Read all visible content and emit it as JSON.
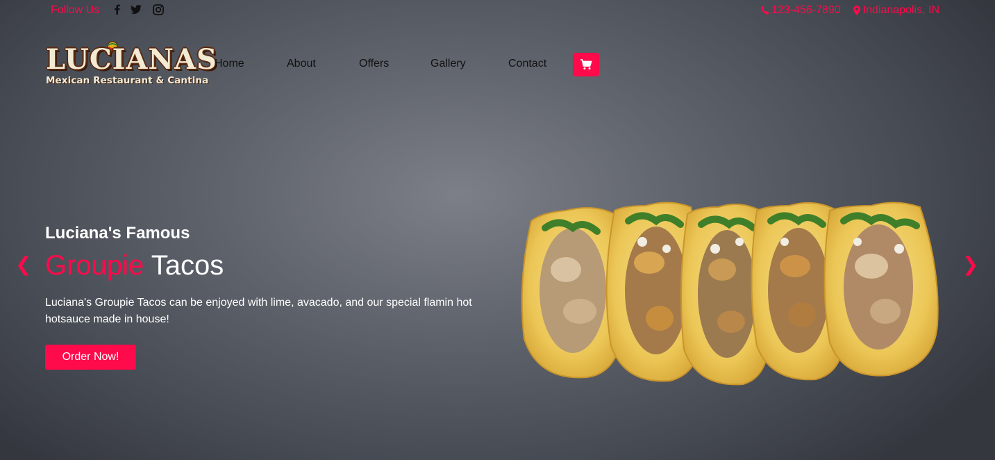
{
  "topbar": {
    "follow_label": "Follow Us",
    "social_icons": [
      "facebook-icon",
      "twitter-icon",
      "instagram-icon"
    ],
    "phone": "123-456-7890",
    "location": "Indianapolis, IN"
  },
  "logo": {
    "name": "LUCIANAS",
    "tagline": "Mexican Restaurant & Cantina"
  },
  "nav": {
    "items": [
      "Home",
      "About",
      "Offers",
      "Gallery",
      "Contact"
    ],
    "cart_icon": "shopping-cart-icon"
  },
  "hero": {
    "subtitle": "Luciana's Famous",
    "title_accent": "Groupie",
    "title_rest": "Tacos",
    "description": "Luciana's Groupie Tacos can be enjoyed with lime, avacado, and our special flamin hot hotsauce made in house!",
    "cta": "Order Now!",
    "prev_arrow": "❮",
    "next_arrow": "❯"
  },
  "colors": {
    "accent": "#ff0a4a",
    "background": "#5e626b"
  }
}
